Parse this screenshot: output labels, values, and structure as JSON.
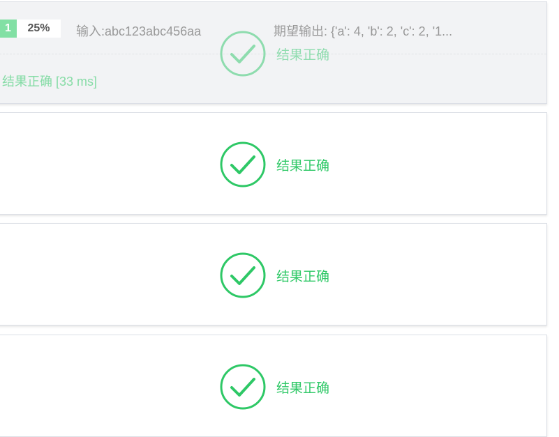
{
  "cases": [
    {
      "number": "1",
      "percent": "25%",
      "input": "输入:abc123abc456aa",
      "expected": "期望输出: {'a': 4, 'b': 2, 'c': 2, '1...",
      "result_detail": "结果正确 [33 ms]",
      "verdict": "结果正确"
    },
    {
      "verdict": "结果正确"
    },
    {
      "verdict": "结果正确"
    },
    {
      "verdict": "结果正确"
    }
  ],
  "colors": {
    "success": "#2ec866",
    "success_faded": "#8edcae",
    "case_badge": "#82e0a4",
    "muted_text": "#999999"
  },
  "icons": {
    "verdict": "check-circle-icon"
  }
}
